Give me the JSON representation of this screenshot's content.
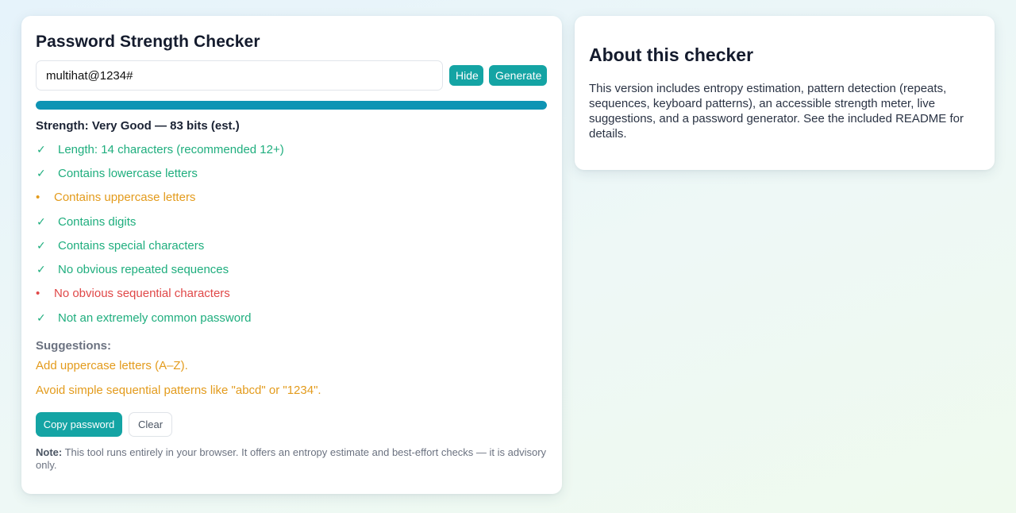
{
  "checker": {
    "title": "Password Strength Checker",
    "password_value": "multihat@1234#",
    "hide_label": "Hide",
    "generate_label": "Generate",
    "meter": {
      "fill_fraction": 1.0,
      "color": "#0e94b4",
      "track_color": "#e2e8ee"
    },
    "strength_text": "Strength: Very Good — 83 bits (est.)",
    "checks": [
      {
        "status": "ok",
        "mark": "✓",
        "label": "Length: 14 characters (recommended 12+)"
      },
      {
        "status": "ok",
        "mark": "✓",
        "label": "Contains lowercase letters"
      },
      {
        "status": "warn",
        "mark": "•",
        "label": "Contains uppercase letters"
      },
      {
        "status": "ok",
        "mark": "✓",
        "label": "Contains digits"
      },
      {
        "status": "ok",
        "mark": "✓",
        "label": "Contains special characters"
      },
      {
        "status": "ok",
        "mark": "✓",
        "label": "No obvious repeated sequences"
      },
      {
        "status": "fail",
        "mark": "•",
        "label": "No obvious sequential characters"
      },
      {
        "status": "ok",
        "mark": "✓",
        "label": "Not an extremely common password"
      }
    ],
    "suggestions_title": "Suggestions:",
    "suggestions": [
      "Add uppercase letters (A–Z).",
      "Avoid simple sequential patterns like \"abcd\" or \"1234\"."
    ],
    "copy_label": "Copy password",
    "clear_label": "Clear",
    "note_label": "Note:",
    "note_text": " This tool runs entirely in your browser. It offers an entropy estimate and best-effort checks — it is advisory only."
  },
  "about": {
    "title": "About this checker",
    "text": "This version includes entropy estimation, pattern detection (repeats, sequences, keyboard patterns), an accessible strength meter, live suggestions, and a password generator. See the included README for details."
  },
  "colors": {
    "accent": "#14a4a4",
    "ok": "#1fae7e",
    "warn": "#e39b1c",
    "fail": "#e04848"
  }
}
